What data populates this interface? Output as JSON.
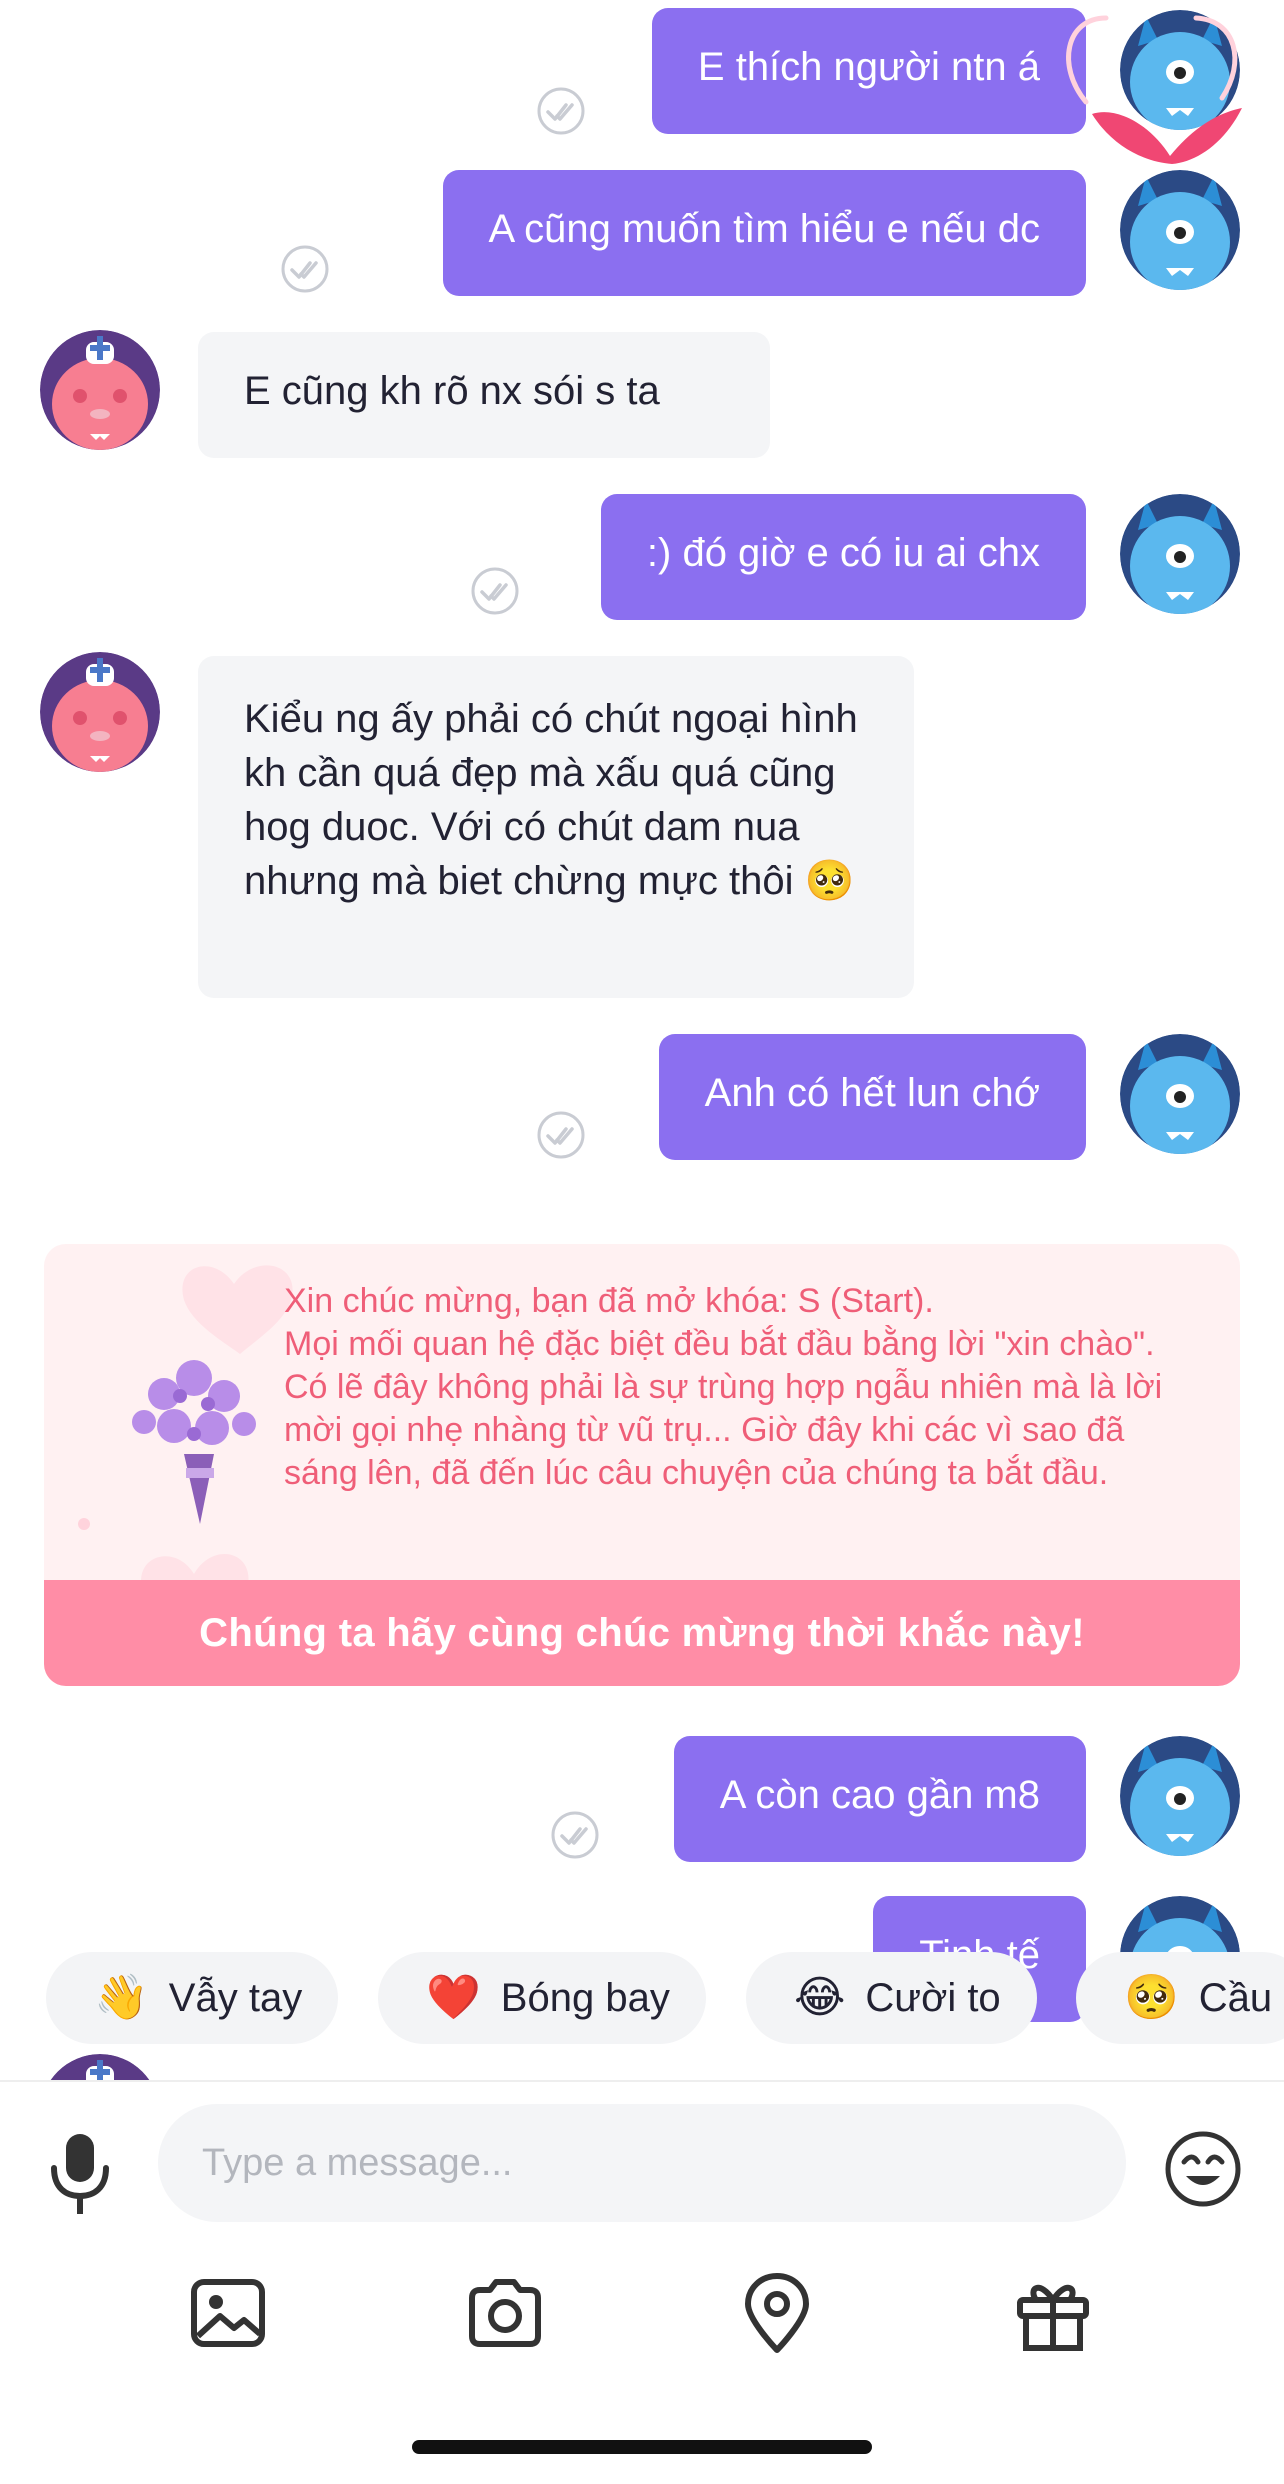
{
  "messages": [
    {
      "side": "me",
      "text": "E thích người ntn á"
    },
    {
      "side": "me",
      "text": "A cũng muốn tìm hiểu e nếu dc"
    },
    {
      "side": "them",
      "text": "E cũng kh rõ nx sói s ta"
    },
    {
      "side": "me",
      "text": ":) đó giờ e có iu ai chx"
    },
    {
      "side": "them",
      "text": "Kiểu ng ấy phải có chút ngoại hình kh cần quá đẹp mà xấu quá cũng hog duoc. Với có chút dam nua nhưng mà biet chừng mực thôi 🥺"
    },
    {
      "side": "me",
      "text": "Anh có hết lun chớ"
    },
    {
      "side": "me",
      "text": "A còn cao gần m8"
    },
    {
      "side": "me",
      "text": "Tinh tế"
    }
  ],
  "celebration": {
    "message": "Xin chúc mừng, bạn đã mở khóa: S (Start).\nMọi mối quan hệ đặc biệt đều bắt đầu bằng lời \"xin chào\". Có lẽ đây không phải là sự trùng hợp ngẫu nhiên mà là lời mời gọi nhẹ nhàng từ vũ trụ... Giờ đây khi các vì sao đã sáng lên, đã đến lúc câu chuyện của chúng ta bắt đầu.",
    "cta": "Chúng ta hãy cùng chúc mừng thời khắc này!"
  },
  "quick_reactions": [
    {
      "emoji": "👋",
      "label": "Vẫy tay"
    },
    {
      "emoji": "❤️",
      "label": "Bóng bay"
    },
    {
      "emoji": "😂",
      "label": "Cười to"
    },
    {
      "emoji": "🥺",
      "label": "Cầu"
    }
  ],
  "composer": {
    "placeholder": "Type a message...",
    "icons": [
      "microphone-icon",
      "emoji-icon",
      "image-icon",
      "camera-icon",
      "location-pin-icon",
      "gift-icon"
    ]
  },
  "colors": {
    "my_bubble": "#8b6ff0",
    "their_bubble": "#f4f5f7",
    "celebration_text": "#ef5e78",
    "celebration_button": "#ff8da6"
  }
}
